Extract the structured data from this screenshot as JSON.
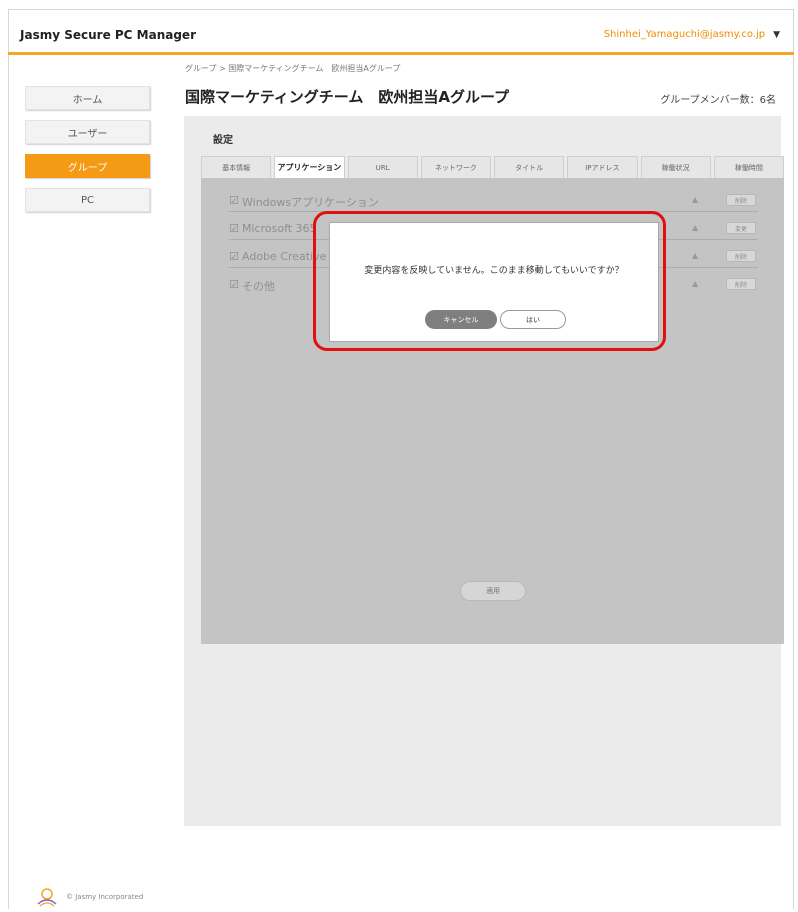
{
  "header": {
    "app_title": "Jasmy Secure PC Manager",
    "user_email": "Shinhei_Yamaguchi@jasmy.co.jp",
    "user_menu_caret": "▼"
  },
  "sidebar": {
    "items": [
      {
        "label": "ホーム"
      },
      {
        "label": "ユーザー"
      },
      {
        "label": "グループ"
      },
      {
        "label": "PC"
      }
    ]
  },
  "main": {
    "breadcrumb": "グループ > 国際マーケティングチーム　欧州担当Aグループ",
    "title": "国際マーケティングチーム　欧州担当Aグループ",
    "member_count": "グループメンバー数：6名",
    "settings_label": "設定",
    "tabs": [
      {
        "label": "基本情報"
      },
      {
        "label": "アプリケーション"
      },
      {
        "label": "URL"
      },
      {
        "label": "ネットワーク"
      },
      {
        "label": "タイトル"
      },
      {
        "label": "IPアドレス"
      },
      {
        "label": "稼働状況"
      },
      {
        "label": "稼働時間"
      }
    ],
    "app_rows": [
      {
        "check": "☑",
        "name": "Windowsアプリケーション",
        "arrow": "▲",
        "action": "削除"
      },
      {
        "check": "☑",
        "name": "Microsoft 365",
        "arrow": "▲",
        "action": "変更"
      },
      {
        "check": "☑",
        "name": "Adobe Creative Cloud",
        "arrow": "▲",
        "action": "削除"
      },
      {
        "check": "☑",
        "name": "その他",
        "arrow": "▲",
        "action": "削除"
      }
    ],
    "apply_label": "適用"
  },
  "dialog": {
    "message": "変更内容を反映していません。このまま移動してもいいですか？",
    "cancel_label": "キャンセル",
    "yes_label": "はい"
  },
  "footer": {
    "copyright": "© Jasmy Incorporated",
    "logo_icon": "jasmy-logo-icon"
  },
  "colors": {
    "accent": "#f59a14",
    "highlight": "#e01010"
  }
}
